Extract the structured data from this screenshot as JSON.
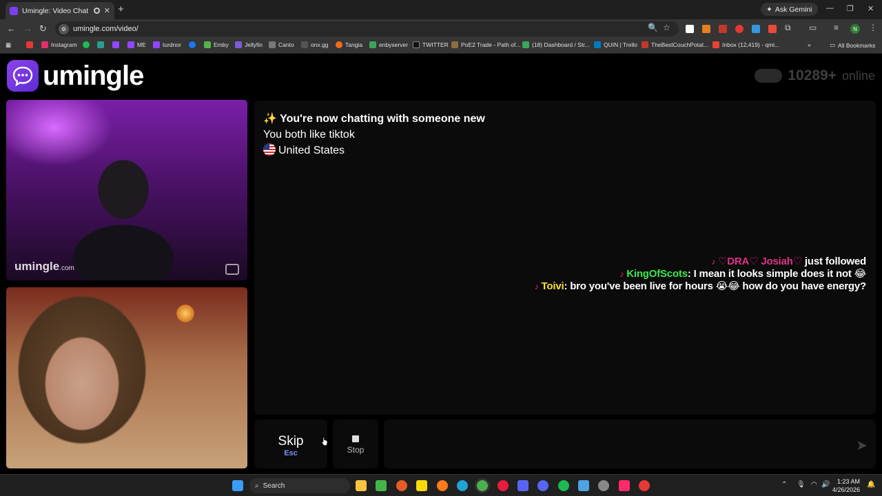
{
  "browser": {
    "tab_title": "Umingle: Video Chat with S",
    "tab_close": "✕",
    "new_tab": "+",
    "url": "umingle.com/video/",
    "ask_gemini": "Ask Gemini",
    "profile_initial": "N",
    "bookmarks": [
      {
        "label": "Instagram",
        "color": "#e1306c"
      },
      {
        "label": "",
        "color": "#1db954"
      },
      {
        "label": "",
        "color": "#2a9d8f"
      },
      {
        "label": "",
        "color": "#9146ff"
      },
      {
        "label": "ME",
        "color": "#9146ff"
      },
      {
        "label": "turdnor",
        "color": "#9146ff"
      },
      {
        "label": "",
        "color": "#1877f2"
      },
      {
        "label": "Emby",
        "color": "#52b54b"
      },
      {
        "label": "Jellyfin",
        "color": "#7b5cd6"
      },
      {
        "label": "Canto",
        "color": "#444444"
      },
      {
        "label": "onx.gg",
        "color": "#333333"
      },
      {
        "label": "Tangia",
        "color": "#f26b1d"
      },
      {
        "label": "enbyserver",
        "color": "#3aa657"
      },
      {
        "label": "TWITTER",
        "color": "#000000"
      },
      {
        "label": "PoE2 Trade - Path of...",
        "color": "#8d6e3f"
      },
      {
        "label": "(18) Dashboard / Str...",
        "color": "#3aa657"
      },
      {
        "label": "QUIN | Trello",
        "color": "#0079bf"
      },
      {
        "label": "TheBestCouchPotat...",
        "color": "#c0392b"
      },
      {
        "label": "Inbox (12,419) - qmi...",
        "color": "#ea4335"
      }
    ],
    "all_bookmarks": "All Bookmarks"
  },
  "header": {
    "logo_text": "umingle",
    "online_count": "10289+",
    "online_label": "online"
  },
  "videos": {
    "watermark_brand": "umingle",
    "watermark_tld": ".com"
  },
  "chat": {
    "headline": "✨ You're now chatting with someone new",
    "common_interest": "You both like tiktok",
    "country": "United States",
    "overlay": {
      "line1_name": "♡DRA♡ Josiah♡",
      "line1_text": "just followed",
      "line2_name": "KingOfScots",
      "line2_text": ": I mean it looks simple does it not 😂",
      "line3_name": "Toivi",
      "line3_text": ": bro you've been live for hours 😭😂 how do you have energy?"
    }
  },
  "controls": {
    "skip_label": "Skip",
    "skip_shortcut": "Esc",
    "stop_label": "Stop",
    "message_placeholder": "",
    "send_icon": "➤"
  },
  "taskbar": {
    "search_label": "Search",
    "time": "1:23 AM",
    "date": "4/26/2026"
  }
}
